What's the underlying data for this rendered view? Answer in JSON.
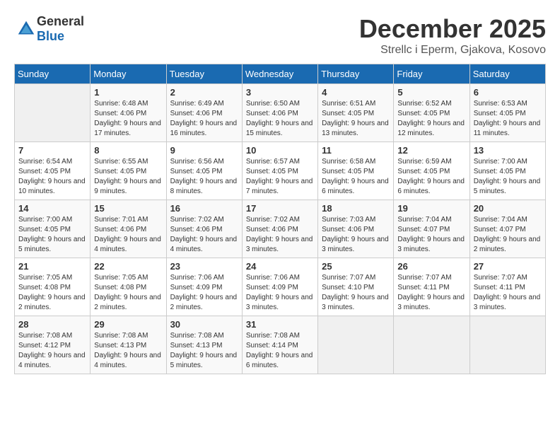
{
  "logo": {
    "general": "General",
    "blue": "Blue"
  },
  "title": {
    "month": "December 2025",
    "location": "Strellc i Eperm, Gjakova, Kosovo"
  },
  "days_of_week": [
    "Sunday",
    "Monday",
    "Tuesday",
    "Wednesday",
    "Thursday",
    "Friday",
    "Saturday"
  ],
  "weeks": [
    [
      {
        "day": "",
        "sunrise": "",
        "sunset": "",
        "daylight": ""
      },
      {
        "day": "1",
        "sunrise": "Sunrise: 6:48 AM",
        "sunset": "Sunset: 4:06 PM",
        "daylight": "Daylight: 9 hours and 17 minutes."
      },
      {
        "day": "2",
        "sunrise": "Sunrise: 6:49 AM",
        "sunset": "Sunset: 4:06 PM",
        "daylight": "Daylight: 9 hours and 16 minutes."
      },
      {
        "day": "3",
        "sunrise": "Sunrise: 6:50 AM",
        "sunset": "Sunset: 4:06 PM",
        "daylight": "Daylight: 9 hours and 15 minutes."
      },
      {
        "day": "4",
        "sunrise": "Sunrise: 6:51 AM",
        "sunset": "Sunset: 4:05 PM",
        "daylight": "Daylight: 9 hours and 13 minutes."
      },
      {
        "day": "5",
        "sunrise": "Sunrise: 6:52 AM",
        "sunset": "Sunset: 4:05 PM",
        "daylight": "Daylight: 9 hours and 12 minutes."
      },
      {
        "day": "6",
        "sunrise": "Sunrise: 6:53 AM",
        "sunset": "Sunset: 4:05 PM",
        "daylight": "Daylight: 9 hours and 11 minutes."
      }
    ],
    [
      {
        "day": "7",
        "sunrise": "Sunrise: 6:54 AM",
        "sunset": "Sunset: 4:05 PM",
        "daylight": "Daylight: 9 hours and 10 minutes."
      },
      {
        "day": "8",
        "sunrise": "Sunrise: 6:55 AM",
        "sunset": "Sunset: 4:05 PM",
        "daylight": "Daylight: 9 hours and 9 minutes."
      },
      {
        "day": "9",
        "sunrise": "Sunrise: 6:56 AM",
        "sunset": "Sunset: 4:05 PM",
        "daylight": "Daylight: 9 hours and 8 minutes."
      },
      {
        "day": "10",
        "sunrise": "Sunrise: 6:57 AM",
        "sunset": "Sunset: 4:05 PM",
        "daylight": "Daylight: 9 hours and 7 minutes."
      },
      {
        "day": "11",
        "sunrise": "Sunrise: 6:58 AM",
        "sunset": "Sunset: 4:05 PM",
        "daylight": "Daylight: 9 hours and 6 minutes."
      },
      {
        "day": "12",
        "sunrise": "Sunrise: 6:59 AM",
        "sunset": "Sunset: 4:05 PM",
        "daylight": "Daylight: 9 hours and 6 minutes."
      },
      {
        "day": "13",
        "sunrise": "Sunrise: 7:00 AM",
        "sunset": "Sunset: 4:05 PM",
        "daylight": "Daylight: 9 hours and 5 minutes."
      }
    ],
    [
      {
        "day": "14",
        "sunrise": "Sunrise: 7:00 AM",
        "sunset": "Sunset: 4:05 PM",
        "daylight": "Daylight: 9 hours and 5 minutes."
      },
      {
        "day": "15",
        "sunrise": "Sunrise: 7:01 AM",
        "sunset": "Sunset: 4:06 PM",
        "daylight": "Daylight: 9 hours and 4 minutes."
      },
      {
        "day": "16",
        "sunrise": "Sunrise: 7:02 AM",
        "sunset": "Sunset: 4:06 PM",
        "daylight": "Daylight: 9 hours and 4 minutes."
      },
      {
        "day": "17",
        "sunrise": "Sunrise: 7:02 AM",
        "sunset": "Sunset: 4:06 PM",
        "daylight": "Daylight: 9 hours and 3 minutes."
      },
      {
        "day": "18",
        "sunrise": "Sunrise: 7:03 AM",
        "sunset": "Sunset: 4:06 PM",
        "daylight": "Daylight: 9 hours and 3 minutes."
      },
      {
        "day": "19",
        "sunrise": "Sunrise: 7:04 AM",
        "sunset": "Sunset: 4:07 PM",
        "daylight": "Daylight: 9 hours and 3 minutes."
      },
      {
        "day": "20",
        "sunrise": "Sunrise: 7:04 AM",
        "sunset": "Sunset: 4:07 PM",
        "daylight": "Daylight: 9 hours and 2 minutes."
      }
    ],
    [
      {
        "day": "21",
        "sunrise": "Sunrise: 7:05 AM",
        "sunset": "Sunset: 4:08 PM",
        "daylight": "Daylight: 9 hours and 2 minutes."
      },
      {
        "day": "22",
        "sunrise": "Sunrise: 7:05 AM",
        "sunset": "Sunset: 4:08 PM",
        "daylight": "Daylight: 9 hours and 2 minutes."
      },
      {
        "day": "23",
        "sunrise": "Sunrise: 7:06 AM",
        "sunset": "Sunset: 4:09 PM",
        "daylight": "Daylight: 9 hours and 2 minutes."
      },
      {
        "day": "24",
        "sunrise": "Sunrise: 7:06 AM",
        "sunset": "Sunset: 4:09 PM",
        "daylight": "Daylight: 9 hours and 3 minutes."
      },
      {
        "day": "25",
        "sunrise": "Sunrise: 7:07 AM",
        "sunset": "Sunset: 4:10 PM",
        "daylight": "Daylight: 9 hours and 3 minutes."
      },
      {
        "day": "26",
        "sunrise": "Sunrise: 7:07 AM",
        "sunset": "Sunset: 4:11 PM",
        "daylight": "Daylight: 9 hours and 3 minutes."
      },
      {
        "day": "27",
        "sunrise": "Sunrise: 7:07 AM",
        "sunset": "Sunset: 4:11 PM",
        "daylight": "Daylight: 9 hours and 3 minutes."
      }
    ],
    [
      {
        "day": "28",
        "sunrise": "Sunrise: 7:08 AM",
        "sunset": "Sunset: 4:12 PM",
        "daylight": "Daylight: 9 hours and 4 minutes."
      },
      {
        "day": "29",
        "sunrise": "Sunrise: 7:08 AM",
        "sunset": "Sunset: 4:13 PM",
        "daylight": "Daylight: 9 hours and 4 minutes."
      },
      {
        "day": "30",
        "sunrise": "Sunrise: 7:08 AM",
        "sunset": "Sunset: 4:13 PM",
        "daylight": "Daylight: 9 hours and 5 minutes."
      },
      {
        "day": "31",
        "sunrise": "Sunrise: 7:08 AM",
        "sunset": "Sunset: 4:14 PM",
        "daylight": "Daylight: 9 hours and 6 minutes."
      },
      {
        "day": "",
        "sunrise": "",
        "sunset": "",
        "daylight": ""
      },
      {
        "day": "",
        "sunrise": "",
        "sunset": "",
        "daylight": ""
      },
      {
        "day": "",
        "sunrise": "",
        "sunset": "",
        "daylight": ""
      }
    ]
  ]
}
